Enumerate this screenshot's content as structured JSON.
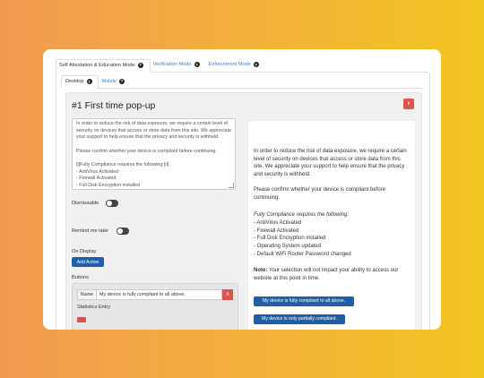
{
  "top_tabs": [
    {
      "label": "Self Attestation & Education Mode",
      "active": true
    },
    {
      "label": "Verification Mode",
      "active": false
    },
    {
      "label": "Enforcement Mode",
      "active": false
    }
  ],
  "sub_tabs": [
    {
      "label": "Desktop",
      "active": true
    },
    {
      "label": "Mobile",
      "active": false
    }
  ],
  "popup": {
    "title": "#1 First time pop-up",
    "close_label": "x",
    "editor_text": "In order to reduce the risk of data exposure, we require a certain level of security on devices that access or store data from this site. We appreciate your support to help ensure that the privacy and security is withheld.\n\nPlease confirm whether your device is compliant before continuing.\n\n[i]Fully Compliance requires the following:[/i]\n- AntiVirus Activated\n- Firewall Activated\n- Full Disk Encryption installed",
    "dismissable_label": "Dismissable",
    "remind_label": "Remind me later",
    "on_display_label": "On Display",
    "add_action_label": "Add Action",
    "buttons_label": "Buttons",
    "name_label": "Name",
    "name_value": "My device is fully compliant to all above.",
    "name_remove": "X",
    "statistics_label": "Statistics Entry"
  },
  "preview": {
    "para1": "In order to reduce the risk of data exposure, we require a certain level of security on devices that access or store data from this site. We appreciate your support to help ensure that the privacy and security is withheld.",
    "para2": "Please confirm whether your device is compliant before continuing.",
    "req_title": "Fully Compliance requires the following:",
    "req_items": [
      "- AntiVirus Activated",
      "- Firewall Activated",
      "- Full Disk Encryption installed",
      "- Operating System updated",
      "- Default WiFi Router Password changed"
    ],
    "note_bold": "Note:",
    "note_text": " Your selection will not impact your ability to access our website at this point in time.",
    "btn1": "My device is fully compliant to all above.",
    "btn2": "My device is only partially compliant."
  },
  "colors": {
    "accent": "#1f5fa8",
    "danger": "#d9534f",
    "link": "#3b7fd1"
  },
  "icons": {
    "help": "question-circle-icon"
  }
}
